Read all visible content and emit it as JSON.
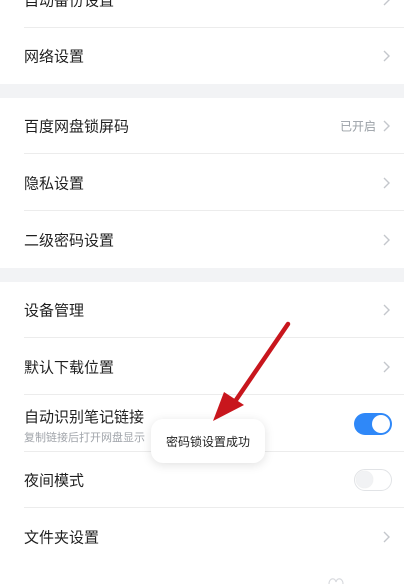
{
  "settings": {
    "group1": {
      "auto_backup_label": "自动备份设置",
      "network_label": "网络设置"
    },
    "group2": {
      "lock_screen_label": "百度网盘锁屏码",
      "lock_screen_value": "已开启",
      "privacy_label": "隐私设置",
      "second_password_label": "二级密码设置"
    },
    "group3": {
      "device_label": "设备管理",
      "download_location_label": "默认下载位置",
      "note_link_label": "自动识别笔记链接",
      "note_link_sub": "复制链接后打开网盘显示",
      "note_link_toggle": true,
      "night_mode_label": "夜间模式",
      "night_mode_toggle": false,
      "folder_label": "文件夹设置"
    }
  },
  "toast": {
    "message": "密码锁设置成功"
  },
  "icons": {
    "chevron": "chevron-right-icon",
    "annotation": "red-arrow-annotation"
  },
  "colors": {
    "toggle_on": "#2f88f8",
    "annotation_arrow": "#c8161d",
    "background": "#f2f3f5"
  }
}
